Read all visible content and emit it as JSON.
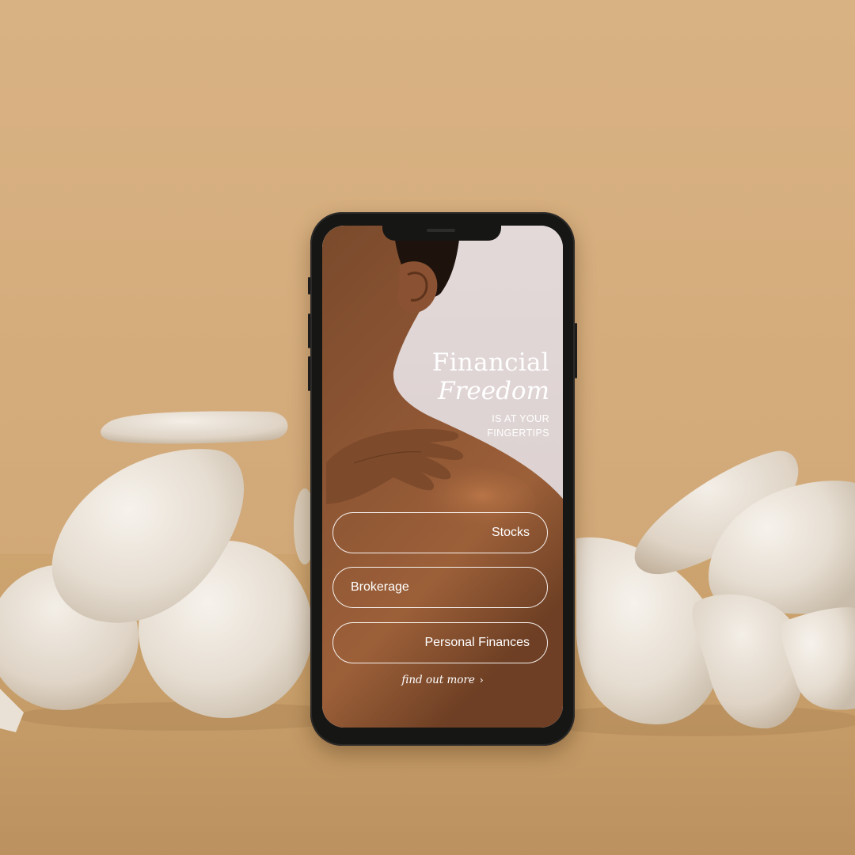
{
  "colors": {
    "backdrop": "#d5ad7d",
    "floor": "#c79e69",
    "phone_frame": "#161615",
    "screen_text": "#ffffff"
  },
  "app": {
    "headline_line1": "Financial",
    "headline_line2": "Freedom",
    "tagline_line1": "IS AT YOUR",
    "tagline_line2": "FINGERTIPS",
    "buttons": [
      {
        "label": "Stocks"
      },
      {
        "label": "Brokerage"
      },
      {
        "label": "Personal Finances"
      }
    ],
    "find_more_label": "find out more",
    "find_more_icon": "chevron-right-icon"
  }
}
